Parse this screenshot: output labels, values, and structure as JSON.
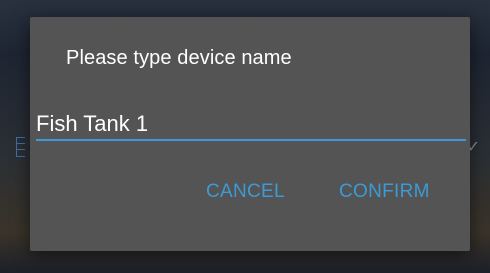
{
  "dialog": {
    "title": "Please type device name",
    "input": {
      "value": "Fish Tank 1"
    },
    "buttons": {
      "cancel": "CANCEL",
      "confirm": "CONFIRM"
    }
  },
  "colors": {
    "accent": "#3d9ad7",
    "dialog_bg": "#545454",
    "text": "#ffffff"
  }
}
